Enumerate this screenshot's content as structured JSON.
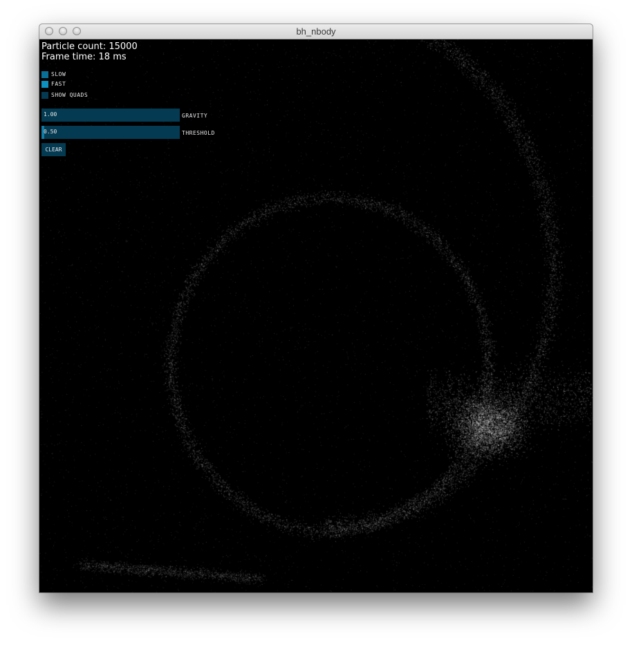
{
  "window": {
    "title": "bh_nbody"
  },
  "info": {
    "particle_count": "Particle count: 15000",
    "frame_time": "Frame time: 18 ms"
  },
  "toggles": [
    {
      "label": "SLOW",
      "active": true,
      "color": "#0a6f96"
    },
    {
      "label": "FAST",
      "active": true,
      "color": "#0d8fc0"
    },
    {
      "label": "SHOW QUADS",
      "active": false,
      "color": "#043a52"
    }
  ],
  "sliders": [
    {
      "label": "GRAVITY",
      "value_text": "1.00",
      "fraction": 0.0
    },
    {
      "label": "THRESHOLD",
      "value_text": "0.50",
      "fraction": 0.02
    }
  ],
  "buttons": {
    "clear": "CLEAR"
  },
  "colors": {
    "control_bg": "#043a52",
    "control_fill": "#0f7aa3",
    "canvas_bg": "#000000",
    "particle": "#ffffff"
  }
}
